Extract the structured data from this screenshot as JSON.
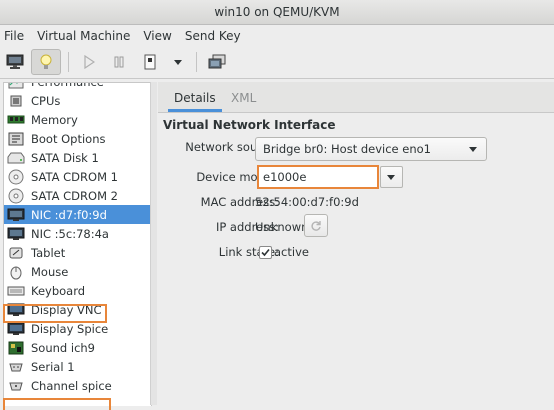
{
  "window": {
    "title": "win10 on QEMU/KVM"
  },
  "menu": {
    "items": [
      "File",
      "Virtual Machine",
      "View",
      "Send Key"
    ]
  },
  "toolbar": {
    "buttons": [
      "monitor-icon",
      "lightbulb-icon",
      "play-icon",
      "pause-icon",
      "power-icon",
      "dropdown-arrow-icon",
      "screenshot-icon"
    ]
  },
  "hardware_list": {
    "items": [
      {
        "label": "Performance",
        "icon": "performance-icon"
      },
      {
        "label": "CPUs",
        "icon": "cpu-icon"
      },
      {
        "label": "Memory",
        "icon": "memory-icon"
      },
      {
        "label": "Boot Options",
        "icon": "boot-options-icon"
      },
      {
        "label": "SATA Disk 1",
        "icon": "disk-icon"
      },
      {
        "label": "SATA CDROM 1",
        "icon": "cdrom-icon"
      },
      {
        "label": "SATA CDROM 2",
        "icon": "cdrom-icon"
      },
      {
        "label": "NIC :d7:f0:9d",
        "icon": "nic-icon",
        "selected": true
      },
      {
        "label": "NIC :5c:78:4a",
        "icon": "nic-icon"
      },
      {
        "label": "Tablet",
        "icon": "tablet-icon"
      },
      {
        "label": "Mouse",
        "icon": "mouse-icon"
      },
      {
        "label": "Keyboard",
        "icon": "keyboard-icon"
      },
      {
        "label": "Display VNC",
        "icon": "display-icon",
        "highlighted": true
      },
      {
        "label": "Display Spice",
        "icon": "display-icon"
      },
      {
        "label": "Sound ich9",
        "icon": "sound-icon"
      },
      {
        "label": "Serial 1",
        "icon": "serial-icon"
      },
      {
        "label": "Channel spice",
        "icon": "channel-icon"
      }
    ]
  },
  "tabs": [
    "Details",
    "XML"
  ],
  "details": {
    "section_title": "Virtual Network Interface",
    "network_source_label": "Network source:",
    "network_source_value": "Bridge br0: Host device eno1",
    "device_model_label": "Device model:",
    "device_model_value": "e1000e",
    "mac_label": "MAC address:",
    "mac_value": "52:54:00:d7:f0:9d",
    "ip_label": "IP address:",
    "ip_value": "Unknown",
    "link_state_label": "Link state:",
    "link_state_value": "active",
    "link_state_checked": true
  },
  "colors": {
    "selection": "#4a90d9",
    "highlight_box": "#e8863a"
  }
}
